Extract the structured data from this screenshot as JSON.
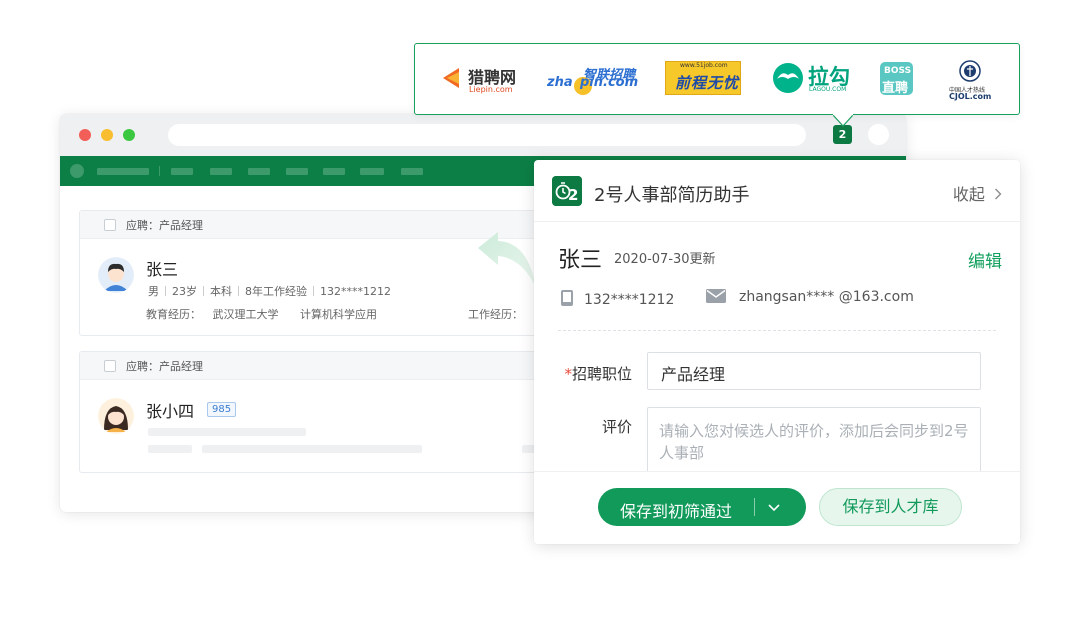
{
  "job_sites": [
    {
      "name": "猎聘网",
      "sub": "Liepin.com"
    },
    {
      "name": "智联招聘",
      "sub": "zhaopin.com",
      "prefix": "zha"
    },
    {
      "name": "前程无忧",
      "sub": "www.51job.com"
    },
    {
      "name": "拉勾",
      "sub": "LAGOU.COM"
    },
    {
      "name": "BOSS直聘",
      "top": "BOSS",
      "bottom": "直聘"
    },
    {
      "name": "中国人才热线",
      "sub": "CJOL.com"
    }
  ],
  "candidates": [
    {
      "applied": "应聘：产品经理",
      "name": "张三",
      "gender": "男",
      "age": "23岁",
      "degree": "本科",
      "experience": "8年工作经验",
      "phone": "132****1212",
      "edu_label": "教育经历：",
      "school": "武汉理工大学",
      "major": "计算机科学应用",
      "work_label": "工作经历："
    },
    {
      "applied": "应聘：产品经理",
      "name": "张小四",
      "badge": "985"
    }
  ],
  "panel": {
    "title": "2号人事部简历助手",
    "collapse": "收起",
    "name": "张三",
    "updated": "2020-07-30更新",
    "edit": "编辑",
    "phone": "132****1212",
    "email": "zhangsan**** @163.com",
    "position_label": "招聘职位",
    "required_mark": "*",
    "position_value": "产品经理",
    "review_label": "评价",
    "review_placeholder": "请输入您对候选人的评价，添加后会同步到2号人事部",
    "save_primary": "保存到初筛通过",
    "save_secondary": "保存到人才库"
  },
  "colors": {
    "brand": "#0c7f46",
    "accent": "#129a5b"
  }
}
